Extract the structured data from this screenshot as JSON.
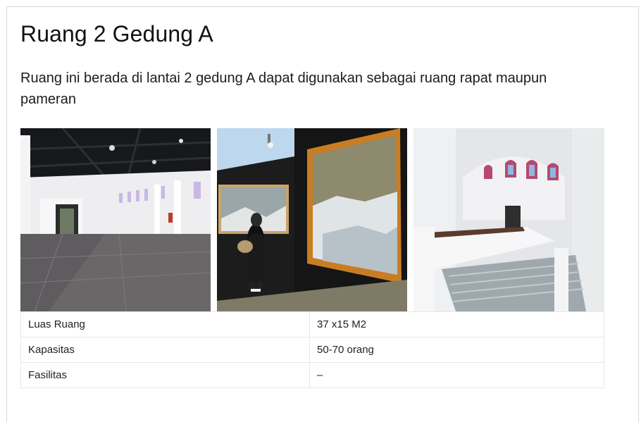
{
  "room": {
    "title": "Ruang 2 Gedung A",
    "description": "Ruang ini berada di lantai 2 gedung A dapat digunakan sebagai ruang rapat maupun pameran"
  },
  "gallery": [
    {
      "kind": "photo",
      "subject": "empty hall"
    },
    {
      "kind": "photo",
      "subject": "exhibition visitor"
    },
    {
      "kind": "photo",
      "subject": "staircase"
    }
  ],
  "details": {
    "rows": [
      {
        "label": "Luas Ruang",
        "value": "37 x15 M2"
      },
      {
        "label": "Kapasitas",
        "value": "50-70 orang"
      },
      {
        "label": "Fasilitas",
        "value": "–"
      }
    ]
  }
}
